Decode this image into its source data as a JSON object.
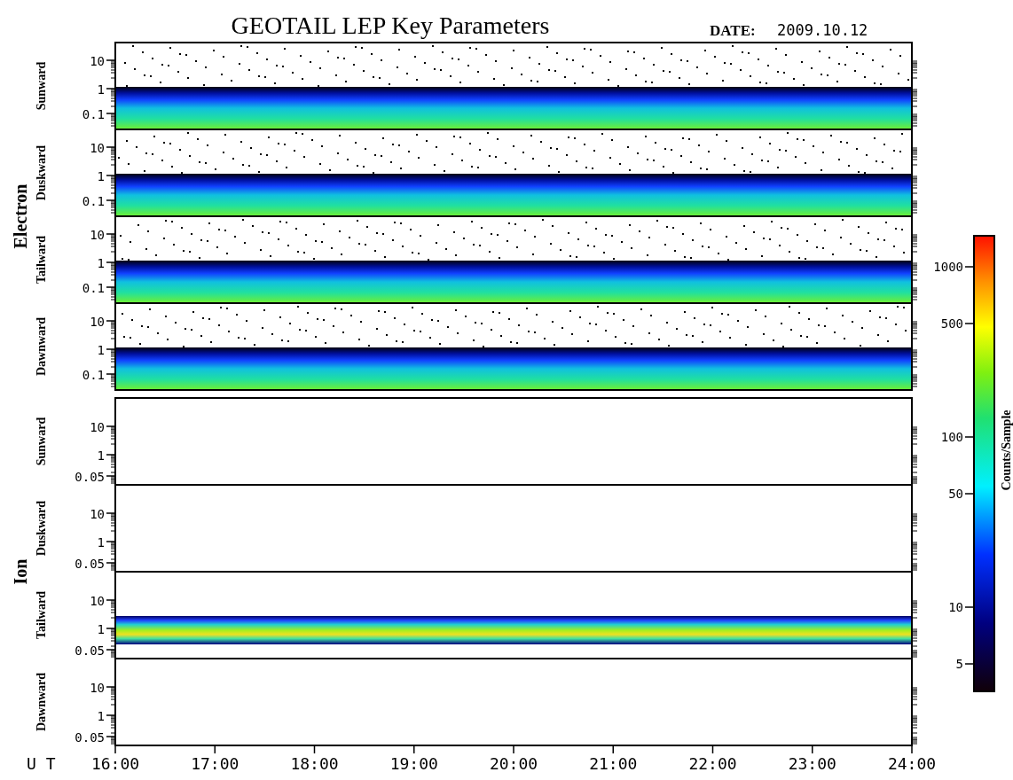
{
  "title": "GEOTAIL LEP Key Parameters",
  "date": {
    "label": "DATE:",
    "value": "2009.10.12"
  },
  "groups": [
    {
      "name": "Electron",
      "panels": [
        {
          "label": "Sunward",
          "kind": "electron",
          "yticks": [
            "10",
            "1",
            "0.1"
          ]
        },
        {
          "label": "Duskward",
          "kind": "electron",
          "yticks": [
            "10",
            "1",
            "0.1"
          ]
        },
        {
          "label": "Tailward",
          "kind": "electron",
          "yticks": [
            "10",
            "1",
            "0.1"
          ]
        },
        {
          "label": "Dawnward",
          "kind": "electron",
          "yticks": [
            "10",
            "1",
            "0.1"
          ]
        }
      ]
    },
    {
      "name": "Ion",
      "panels": [
        {
          "label": "Sunward",
          "kind": "blank",
          "yticks": [
            "10",
            "1",
            "0.05"
          ]
        },
        {
          "label": "Duskward",
          "kind": "blank",
          "yticks": [
            "10",
            "1",
            "0.05"
          ]
        },
        {
          "label": "Tailward",
          "kind": "ion",
          "yticks": [
            "10",
            "1",
            "0.05"
          ]
        },
        {
          "label": "Dawnward",
          "kind": "blank",
          "yticks": [
            "10",
            "1",
            "0.05"
          ]
        }
      ]
    }
  ],
  "x_axis": {
    "label": "U T",
    "ticks": [
      "16:00",
      "17:00",
      "18:00",
      "19:00",
      "20:00",
      "21:00",
      "22:00",
      "23:00",
      "24:00"
    ]
  },
  "colorbar": {
    "label": "Counts/Sample",
    "ticks": [
      "1000",
      "500",
      "100",
      "50",
      "10",
      "5"
    ]
  }
}
